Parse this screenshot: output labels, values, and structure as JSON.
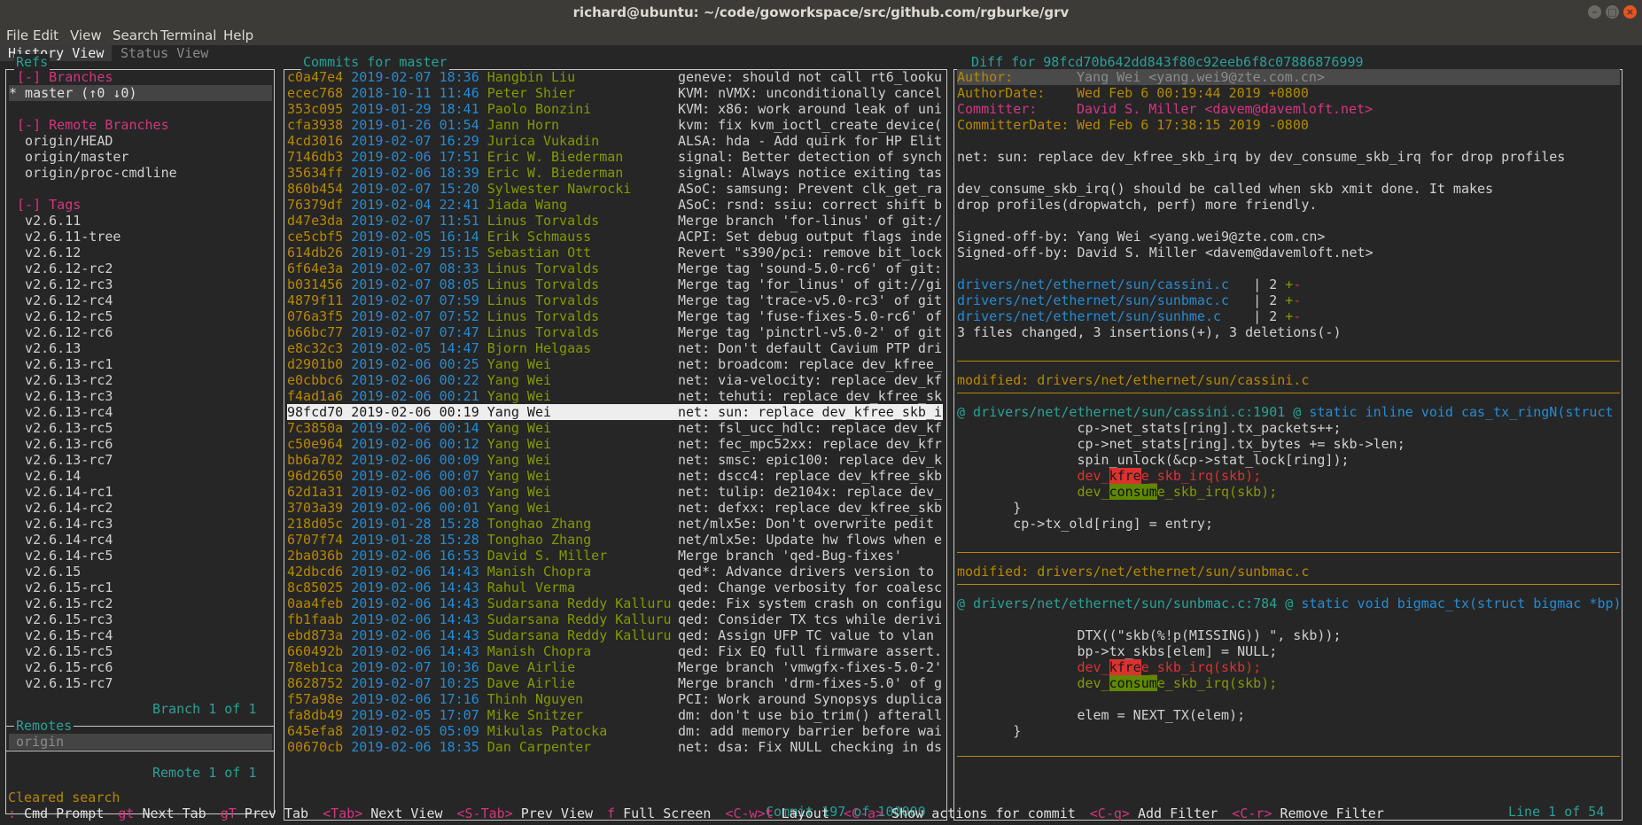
{
  "window": {
    "title": "richard@ubuntu: ~/code/goworkspace/src/github.com/rgburke/grv"
  },
  "menu": [
    "File",
    "Edit",
    "View",
    "Search",
    "Terminal",
    "Help"
  ],
  "tabs": {
    "active": "History View",
    "inactive": "Status View"
  },
  "refs": {
    "title": "Refs",
    "branches_header": "[-] Branches",
    "master": "* master (↑0 ↓0)",
    "remote_branches_header": "[-] Remote Branches",
    "remote_branches": [
      "origin/HEAD",
      "origin/master",
      "origin/proc-cmdline"
    ],
    "tags_header": "[-] Tags",
    "tags": [
      "v2.6.11",
      "v2.6.11-tree",
      "v2.6.12",
      "v2.6.12-rc2",
      "v2.6.12-rc3",
      "v2.6.12-rc4",
      "v2.6.12-rc5",
      "v2.6.12-rc6",
      "v2.6.13",
      "v2.6.13-rc1",
      "v2.6.13-rc2",
      "v2.6.13-rc3",
      "v2.6.13-rc4",
      "v2.6.13-rc5",
      "v2.6.13-rc6",
      "v2.6.13-rc7",
      "v2.6.14",
      "v2.6.14-rc1",
      "v2.6.14-rc2",
      "v2.6.14-rc3",
      "v2.6.14-rc4",
      "v2.6.14-rc5",
      "v2.6.15",
      "v2.6.15-rc1",
      "v2.6.15-rc2",
      "v2.6.15-rc3",
      "v2.6.15-rc4",
      "v2.6.15-rc5",
      "v2.6.15-rc6",
      "v2.6.15-rc7"
    ],
    "footer": "Branch 1 of 1"
  },
  "remotes": {
    "title": "Remotes",
    "items": [
      "origin"
    ],
    "footer": "Remote 1 of 1"
  },
  "commits": {
    "title": "Commits for master",
    "footer": "Commit 197 of 100000",
    "selected_index": 21,
    "rows": [
      {
        "hash": "c0a47e4",
        "date": "2019-02-07",
        "time": "18:36",
        "author": "Hangbin Liu",
        "msg": "geneve: should not call rt6_looku"
      },
      {
        "hash": "ecec768",
        "date": "2018-10-11",
        "time": "11:46",
        "author": "Peter Shier",
        "msg": "KVM: nVMX: unconditionally cancel"
      },
      {
        "hash": "353c095",
        "date": "2019-01-29",
        "time": "18:41",
        "author": "Paolo Bonzini",
        "msg": "KVM: x86: work around leak of uni"
      },
      {
        "hash": "cfa3938",
        "date": "2019-01-26",
        "time": "01:54",
        "author": "Jann Horn",
        "msg": "kvm: fix kvm_ioctl_create_device("
      },
      {
        "hash": "4cd3016",
        "date": "2019-02-07",
        "time": "16:29",
        "author": "Jurica Vukadin",
        "msg": "ALSA: hda - Add quirk for HP Elit"
      },
      {
        "hash": "7146db3",
        "date": "2019-02-06",
        "time": "17:51",
        "author": "Eric W. Biederman",
        "msg": "signal: Better detection of synch"
      },
      {
        "hash": "35634ff",
        "date": "2019-02-06",
        "time": "18:39",
        "author": "Eric W. Biederman",
        "msg": "signal: Always notice exiting tas"
      },
      {
        "hash": "860b454",
        "date": "2019-02-07",
        "time": "15:20",
        "author": "Sylwester Nawrocki",
        "msg": "ASoC: samsung: Prevent clk_get_ra"
      },
      {
        "hash": "76379df",
        "date": "2019-02-04",
        "time": "22:41",
        "author": "Jiada Wang",
        "msg": "ASoC: rsnd: ssiu: correct shift b"
      },
      {
        "hash": "d47e3da",
        "date": "2019-02-07",
        "time": "11:51",
        "author": "Linus Torvalds",
        "msg": "Merge branch 'for-linus' of git:/"
      },
      {
        "hash": "ce5cbf5",
        "date": "2019-02-05",
        "time": "16:14",
        "author": "Erik Schmauss",
        "msg": "ACPI: Set debug output flags inde"
      },
      {
        "hash": "614db26",
        "date": "2019-01-29",
        "time": "15:15",
        "author": "Sebastian Ott",
        "msg": "Revert \"s390/pci: remove bit_lock"
      },
      {
        "hash": "6f64e3a",
        "date": "2019-02-07",
        "time": "08:33",
        "author": "Linus Torvalds",
        "msg": "Merge tag 'sound-5.0-rc6' of git:"
      },
      {
        "hash": "b031456",
        "date": "2019-02-07",
        "time": "08:05",
        "author": "Linus Torvalds",
        "msg": "Merge tag 'for_linus' of git://gi"
      },
      {
        "hash": "4879f11",
        "date": "2019-02-07",
        "time": "07:59",
        "author": "Linus Torvalds",
        "msg": "Merge tag 'trace-v5.0-rc3' of git"
      },
      {
        "hash": "076a3f5",
        "date": "2019-02-07",
        "time": "07:52",
        "author": "Linus Torvalds",
        "msg": "Merge tag 'fuse-fixes-5.0-rc6' of"
      },
      {
        "hash": "b66bc77",
        "date": "2019-02-07",
        "time": "07:47",
        "author": "Linus Torvalds",
        "msg": "Merge tag 'pinctrl-v5.0-2' of git"
      },
      {
        "hash": "e8c32c3",
        "date": "2019-02-05",
        "time": "14:47",
        "author": "Bjorn Helgaas",
        "msg": "net: Don't default Cavium PTP dri"
      },
      {
        "hash": "d2901b0",
        "date": "2019-02-06",
        "time": "00:25",
        "author": "Yang Wei",
        "msg": "net: broadcom: replace dev_kfree_"
      },
      {
        "hash": "e0cbbc6",
        "date": "2019-02-06",
        "time": "00:22",
        "author": "Yang Wei",
        "msg": "net: via-velocity: replace dev_kf"
      },
      {
        "hash": "f4ad1a6",
        "date": "2019-02-06",
        "time": "00:21",
        "author": "Yang Wei",
        "msg": "net: tehuti: replace dev_kfree_sk"
      },
      {
        "hash": "98fcd70",
        "date": "2019-02-06",
        "time": "00:19",
        "author": "Yang Wei",
        "msg": "net: sun: replace dev_kfree_skb_i"
      },
      {
        "hash": "7c3850a",
        "date": "2019-02-06",
        "time": "00:14",
        "author": "Yang Wei",
        "msg": "net: fsl_ucc_hdlc: replace dev_kf"
      },
      {
        "hash": "c50e964",
        "date": "2019-02-06",
        "time": "00:12",
        "author": "Yang Wei",
        "msg": "net: fec_mpc52xx: replace dev_kfr"
      },
      {
        "hash": "bb6a702",
        "date": "2019-02-06",
        "time": "00:09",
        "author": "Yang Wei",
        "msg": "net: smsc: epic100: replace dev_k"
      },
      {
        "hash": "96d2650",
        "date": "2019-02-06",
        "time": "00:07",
        "author": "Yang Wei",
        "msg": "net: dscc4: replace dev_kfree_skb"
      },
      {
        "hash": "62d1a31",
        "date": "2019-02-06",
        "time": "00:03",
        "author": "Yang Wei",
        "msg": "net: tulip: de2104x: replace dev_"
      },
      {
        "hash": "3703a39",
        "date": "2019-02-06",
        "time": "00:01",
        "author": "Yang Wei",
        "msg": "net: defxx: replace dev_kfree_skb"
      },
      {
        "hash": "218d05c",
        "date": "2019-01-28",
        "time": "15:28",
        "author": "Tonghao Zhang",
        "msg": "net/mlx5e: Don't overwrite pedit"
      },
      {
        "hash": "6707f74",
        "date": "2019-01-28",
        "time": "15:28",
        "author": "Tonghao Zhang",
        "msg": "net/mlx5e: Update hw flows when e"
      },
      {
        "hash": "2ba036b",
        "date": "2019-02-06",
        "time": "16:53",
        "author": "David S. Miller",
        "msg": "Merge branch 'qed-Bug-fixes'"
      },
      {
        "hash": "42dbcd6",
        "date": "2019-02-06",
        "time": "14:43",
        "author": "Manish Chopra",
        "msg": "qed*: Advance drivers version to"
      },
      {
        "hash": "8c85025",
        "date": "2019-02-06",
        "time": "14:43",
        "author": "Rahul Verma",
        "msg": "qed: Change verbosity for coalesc"
      },
      {
        "hash": "0aa4feb",
        "date": "2019-02-06",
        "time": "14:43",
        "author": "Sudarsana Reddy Kalluru",
        "msg": "qede: Fix system crash on configu"
      },
      {
        "hash": "fb1faab",
        "date": "2019-02-06",
        "time": "14:43",
        "author": "Sudarsana Reddy Kalluru",
        "msg": "qed: Consider TX tcs while derivi"
      },
      {
        "hash": "ebd873a",
        "date": "2019-02-06",
        "time": "14:43",
        "author": "Sudarsana Reddy Kalluru",
        "msg": "qed: Assign UFP TC value to vlan"
      },
      {
        "hash": "660492b",
        "date": "2019-02-06",
        "time": "14:43",
        "author": "Manish Chopra",
        "msg": "qed: Fix EQ full firmware assert."
      },
      {
        "hash": "78eb1ca",
        "date": "2019-02-07",
        "time": "10:36",
        "author": "Dave Airlie",
        "msg": "Merge branch 'vmwgfx-fixes-5.0-2'"
      },
      {
        "hash": "8628752",
        "date": "2019-02-07",
        "time": "10:25",
        "author": "Dave Airlie",
        "msg": "Merge branch 'drm-fixes-5.0' of g"
      },
      {
        "hash": "f57a98e",
        "date": "2019-02-06",
        "time": "17:16",
        "author": "Thinh Nguyen",
        "msg": "PCI: Work around Synopsys duplica"
      },
      {
        "hash": "fa8db49",
        "date": "2019-02-05",
        "time": "17:07",
        "author": "Mike Snitzer",
        "msg": "dm: don't use bio_trim() afterall"
      },
      {
        "hash": "645efa8",
        "date": "2019-02-05",
        "time": "05:09",
        "author": "Mikulas Patocka",
        "msg": "dm: add memory barrier before wai"
      },
      {
        "hash": "00670cb",
        "date": "2019-02-06",
        "time": "18:35",
        "author": "Dan Carpenter",
        "msg": "net: dsa: Fix NULL checking in ds"
      }
    ]
  },
  "diff": {
    "title": "Diff for 98fcd70b642dd843f80c92eeb6f8c07886876999",
    "footer": "Line 1 of 54",
    "author_label": "Author:",
    "author_val": "Yang Wei <yang.wei9@zte.com.cn>",
    "authordate_label": "AuthorDate:",
    "authordate_val": "Wed Feb 6 00:19:44 2019 +0800",
    "committer_label": "Committer:",
    "committer_val": "David S. Miller <davem@davemloft.net>",
    "committerdate_label": "CommitterDate:",
    "committerdate_val": "Wed Feb 6 17:38:15 2019 -0800",
    "subject": "net: sun: replace dev_kfree_skb_irq by dev_consume_skb_irq for drop profiles",
    "body1": "dev_consume_skb_irq() should be called when skb xmit done. It makes",
    "body2": "drop profiles(dropwatch, perf) more friendly.",
    "signoff1": "Signed-off-by: Yang Wei <yang.wei9@zte.com.cn>",
    "signoff2": "Signed-off-by: David S. Miller <davem@davemloft.net>",
    "stat_files": [
      "drivers/net/ethernet/sun/cassini.c",
      "drivers/net/ethernet/sun/sunbmac.c",
      "drivers/net/ethernet/sun/sunhme.c"
    ],
    "stat_pads": [
      "  ",
      "  ",
      "   "
    ],
    "stat_count": " | 2 ",
    "stat_plus": "+",
    "stat_minus": "-",
    "stat_summary": "3 files changed, 3 insertions(+), 3 deletions(-)",
    "mod1": "modified: drivers/net/ethernet/sun/cassini.c",
    "hunk1_loc": "@ drivers/net/ethernet/sun/cassini.c:1901 @",
    "hunk1_ctx": " static inline void cas_tx_ringN(struct",
    "h1l1": "               cp->net_stats[ring].tx_packets++;",
    "h1l2": "               cp->net_stats[ring].tx_bytes += skb->len;",
    "h1l3": "               spin_unlock(&cp->stat_lock[ring]);",
    "indent15": "               ",
    "indent7": "       ",
    "del_a": "dev_",
    "del_b": "kfre",
    "del_c": "e_skb_irq(skb);",
    "add_a": "dev_",
    "add_b": "consum",
    "add_c": "e_skb_irq(skb);",
    "h1l6": "       }",
    "h1l7": "       cp->tx_old[ring] = entry;",
    "mod2": "modified: drivers/net/ethernet/sun/sunbmac.c",
    "hunk2_loc": "@ drivers/net/ethernet/sun/sunbmac.c:784 @",
    "hunk2_ctx": " static void bigmac_tx(struct bigmac *bp)",
    "h2l1": "               DTX((\"skb(%!p(MISSING)) \", skb));",
    "h2l2": "               bp->tx_skbs[elem] = NULL;",
    "h2l5": "               elem = NEXT_TX(elem);",
    "h2l6": "       }"
  },
  "status": "Cleared search",
  "shortcuts": [
    {
      "key": ":",
      "label": "Cmd Prompt"
    },
    {
      "key": "gt",
      "label": "Next Tab"
    },
    {
      "key": "gT",
      "label": "Prev Tab"
    },
    {
      "key": "<Tab>",
      "label": "Next View"
    },
    {
      "key": "<S-Tab>",
      "label": "Prev View"
    },
    {
      "key": "f",
      "label": "Full Screen"
    },
    {
      "key": "<C-w>t",
      "label": "Layout"
    },
    {
      "key": "<C-a>",
      "label": "Show actions for commit"
    },
    {
      "key": "<C-q>",
      "label": "Add Filter"
    },
    {
      "key": "<C-r>",
      "label": "Remove Filter"
    }
  ],
  "colors": {
    "hash": "#b58900",
    "date": "#268bd2",
    "author": "#859900",
    "branch": "#d33682",
    "title": "#2aa198"
  }
}
